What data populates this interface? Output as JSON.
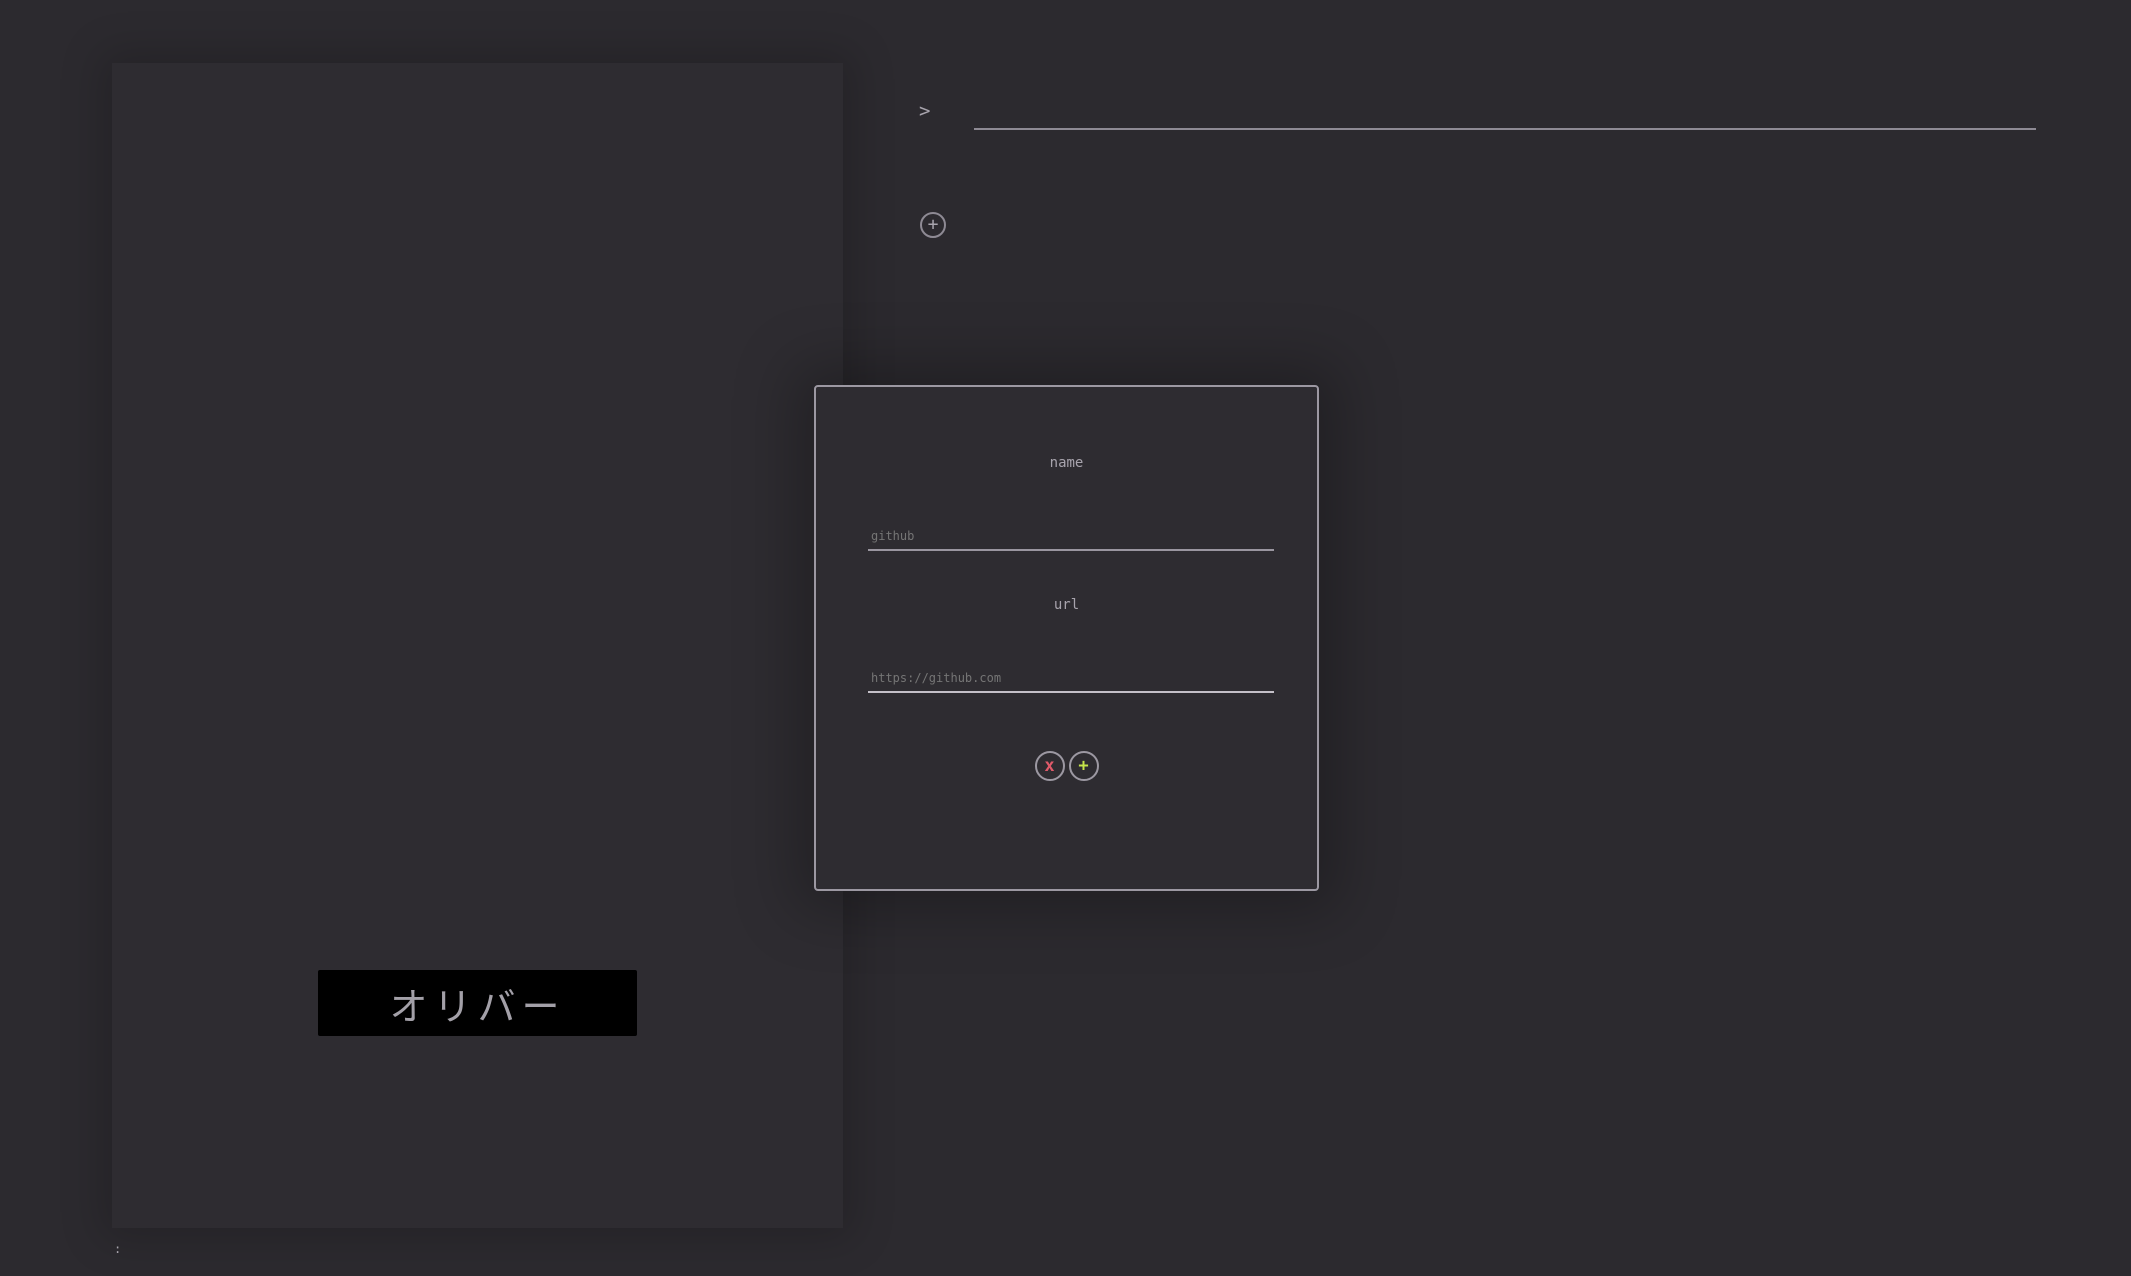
{
  "profile": {
    "display_name": "オリバー",
    "status_text": ":"
  },
  "command_bar": {
    "prompt": ">",
    "value": ""
  },
  "links": {
    "add_icon": "+"
  },
  "modal": {
    "name_label": "name",
    "name_placeholder": "github",
    "url_label": "url",
    "url_placeholder": "https://github.com",
    "cancel_icon": "x",
    "confirm_icon": "+"
  },
  "colors": {
    "background": "#2c2a2f",
    "cancel": "#e05a6a",
    "confirm": "#c6e54a"
  }
}
